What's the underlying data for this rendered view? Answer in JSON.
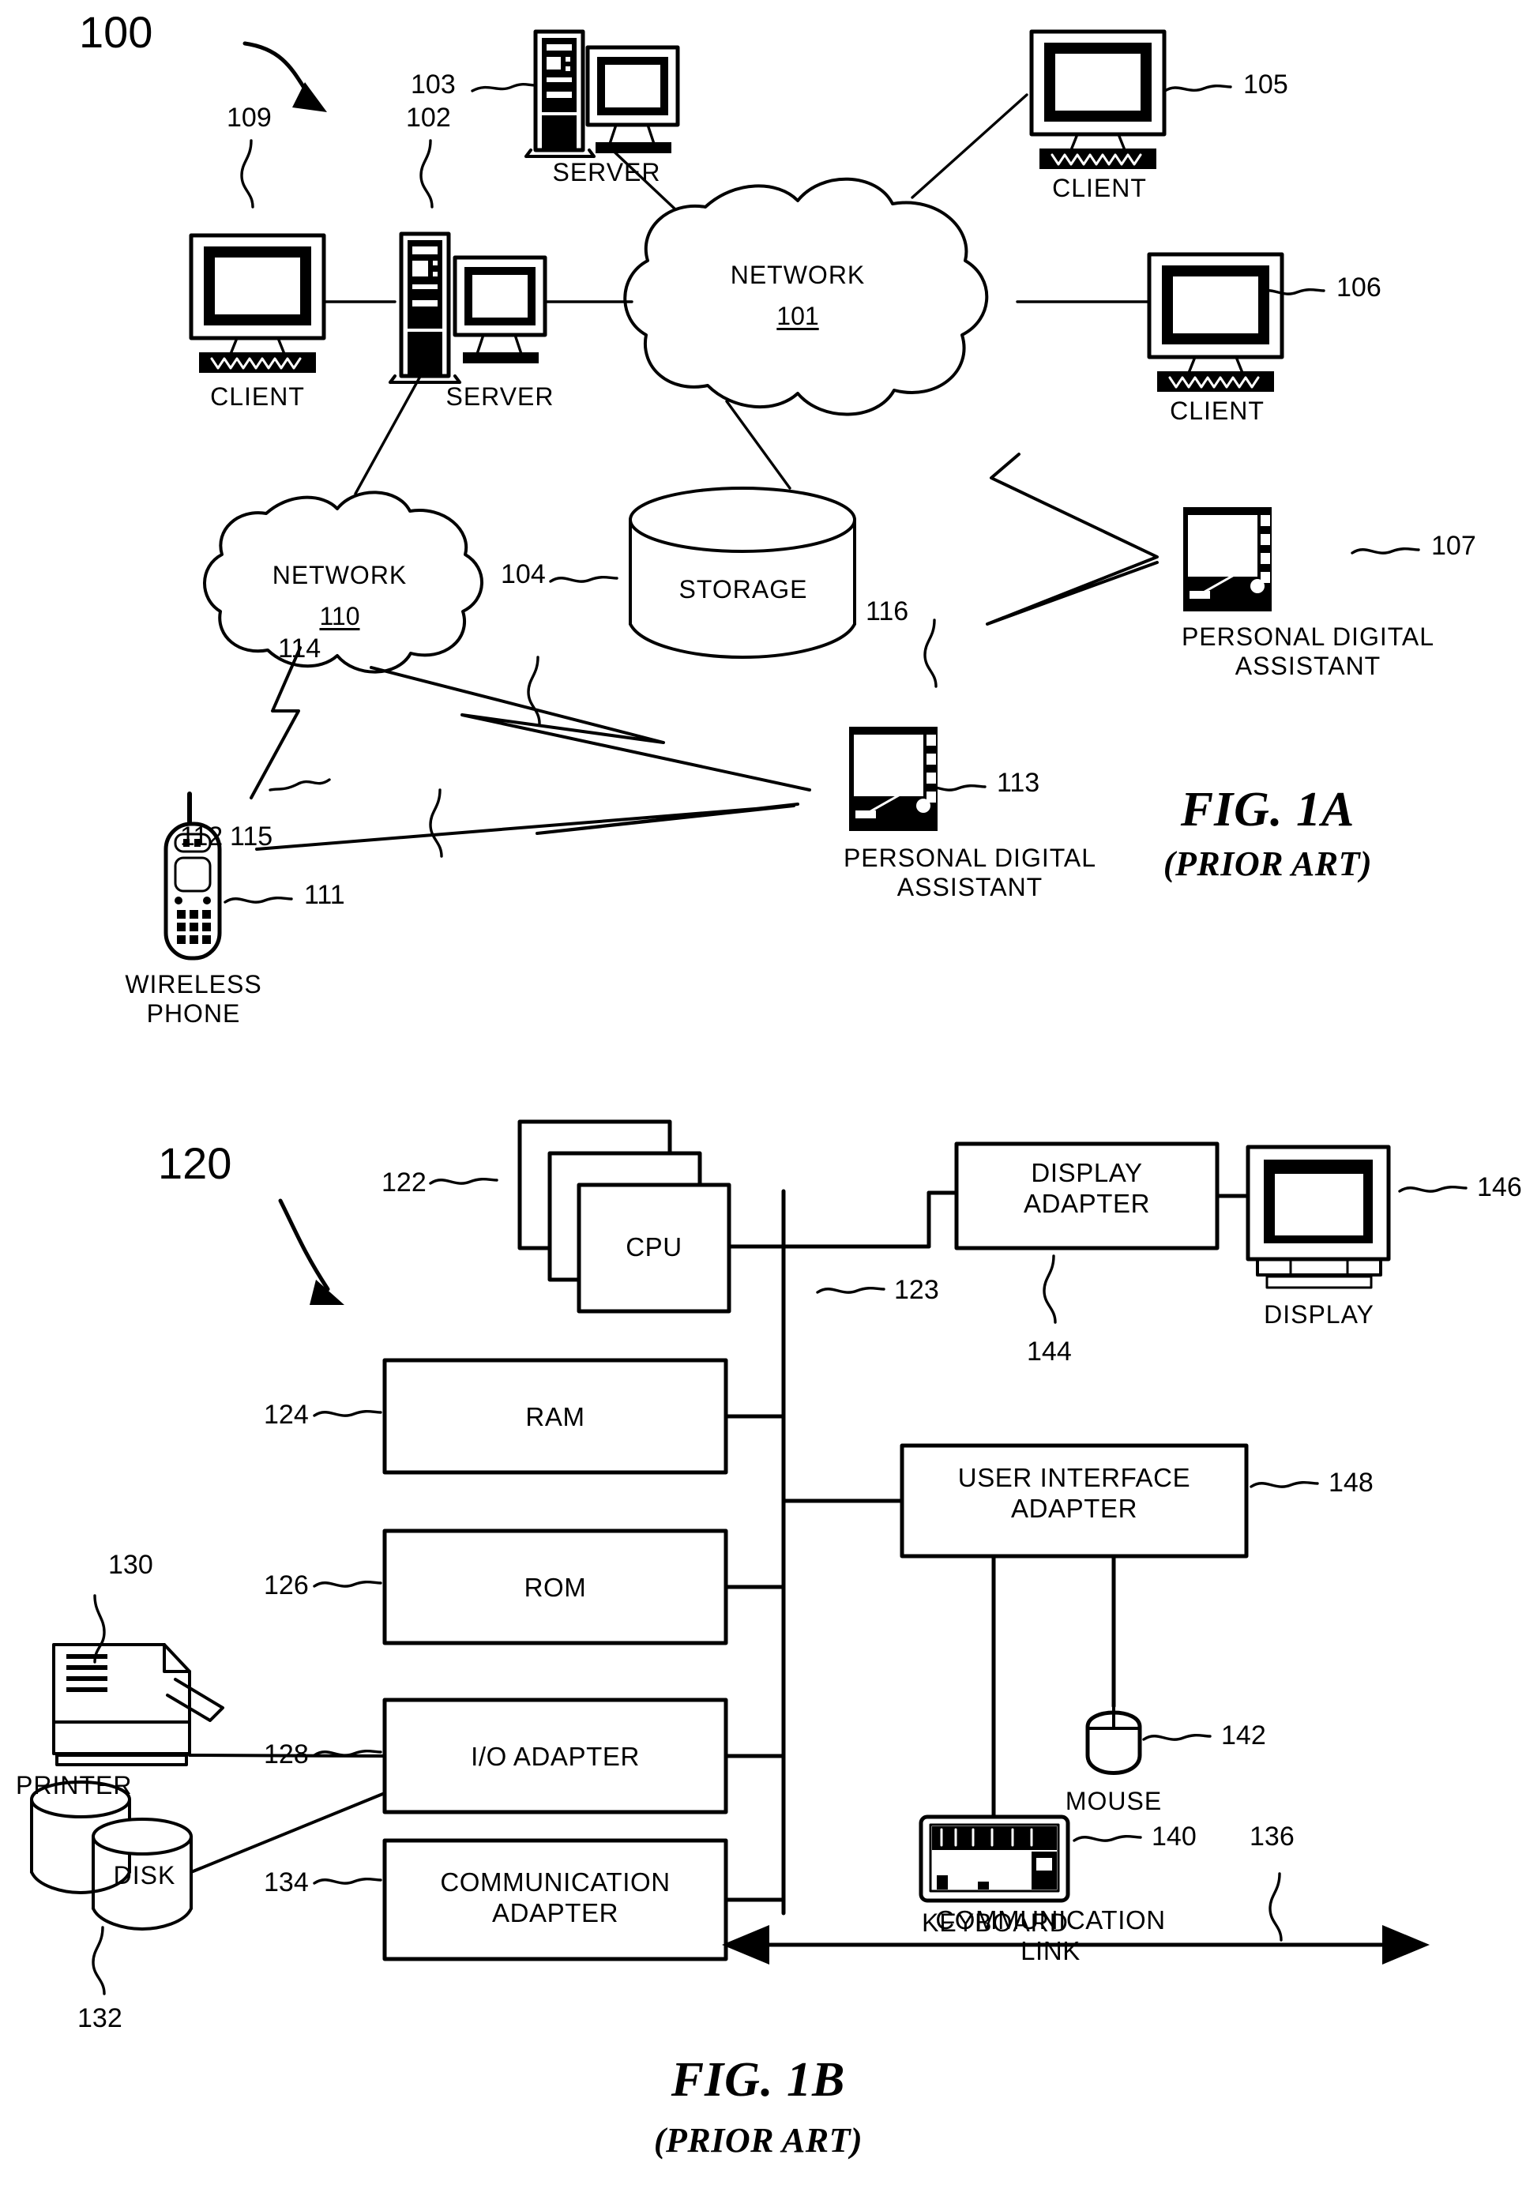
{
  "document": {
    "title": "Patent drawing sheet — FIG. 1A and FIG. 1B (Prior Art)",
    "ink_color": "#000000",
    "paper_color": "#ffffff"
  },
  "fig1a": {
    "system_ref": "100",
    "caption_main": "FIG. 1A",
    "caption_sub": "(PRIOR ART)",
    "nodes": [
      {
        "ref": "109",
        "label": "CLIENT",
        "icon": "desktop-computer-icon"
      },
      {
        "ref": "102",
        "label": "SERVER",
        "icon": "server-tower-icon"
      },
      {
        "ref": "103",
        "label": "SERVER",
        "icon": "server-tower-icon"
      },
      {
        "ref": "105",
        "label": "CLIENT",
        "icon": "desktop-computer-icon"
      },
      {
        "ref": "106",
        "label": "CLIENT",
        "icon": "desktop-computer-icon"
      },
      {
        "ref": "104",
        "label": "STORAGE",
        "icon": "database-cylinder-icon"
      },
      {
        "ref": "107",
        "label": "PERSONAL DIGITAL ASSISTANT",
        "icon": "pda-icon"
      },
      {
        "ref": "113",
        "label": "PERSONAL DIGITAL ASSISTANT",
        "icon": "pda-icon"
      },
      {
        "ref": "111",
        "label": "WIRELESS PHONE",
        "icon": "mobile-phone-icon"
      }
    ],
    "clouds": [
      {
        "ref": "101",
        "label": "NETWORK"
      },
      {
        "ref": "110",
        "label": "NETWORK"
      }
    ],
    "wireless_links": [
      {
        "ref": "112"
      },
      {
        "ref": "114"
      },
      {
        "ref": "115"
      },
      {
        "ref": "116"
      }
    ]
  },
  "fig1b": {
    "system_ref": "120",
    "caption_main": "FIG. 1B",
    "caption_sub": "(PRIOR ART)",
    "blocks": [
      {
        "ref": "122",
        "label": "CPU"
      },
      {
        "ref": "124",
        "label": "RAM"
      },
      {
        "ref": "126",
        "label": "ROM"
      },
      {
        "ref": "128",
        "label": "I/O ADAPTER"
      },
      {
        "ref": "134",
        "label": "COMMUNICATION\nADAPTER"
      },
      {
        "ref": "144",
        "label": "DISPLAY\nADAPTER"
      },
      {
        "ref": "148",
        "label": "USER INTERFACE\nADAPTER"
      }
    ],
    "peripherals": [
      {
        "ref": "130",
        "label": "PRINTER",
        "icon": "printer-icon"
      },
      {
        "ref": "132",
        "label": "DISK",
        "icon": "disk-drive-icon"
      },
      {
        "ref": "146",
        "label": "DISPLAY",
        "icon": "monitor-icon"
      },
      {
        "ref": "142",
        "label": "MOUSE",
        "icon": "mouse-icon"
      },
      {
        "ref": "140",
        "label": "KEYBOARD",
        "icon": "keyboard-icon"
      }
    ],
    "bus": {
      "ref": "123"
    },
    "comm_link": {
      "ref": "136",
      "label": "COMMUNICATION\nLINK"
    }
  }
}
